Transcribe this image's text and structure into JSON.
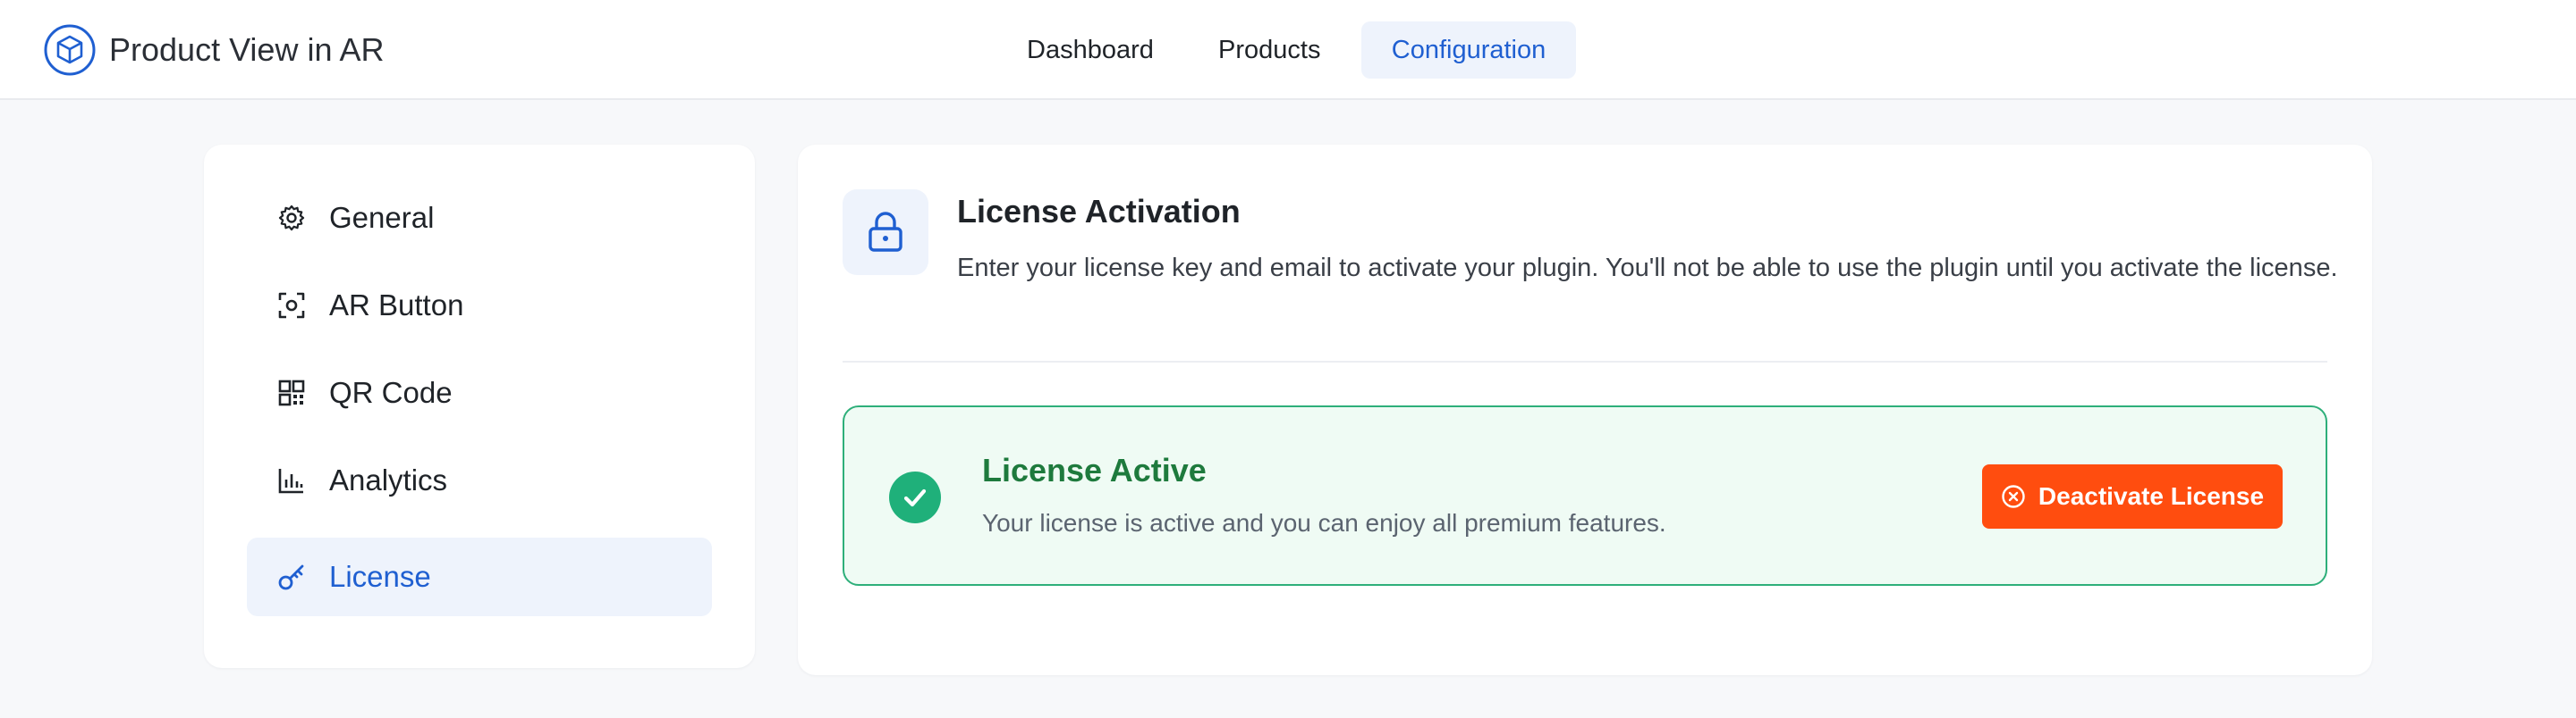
{
  "app": {
    "title": "Product View in AR",
    "brand_color": "#1f5fd1"
  },
  "nav": {
    "items": [
      {
        "label": "Dashboard",
        "active": false
      },
      {
        "label": "Products",
        "active": false
      },
      {
        "label": "Configuration",
        "active": true
      }
    ]
  },
  "sidebar": {
    "items": [
      {
        "label": "General",
        "icon": "gear-icon",
        "active": false
      },
      {
        "label": "AR Button",
        "icon": "scan-icon",
        "active": false
      },
      {
        "label": "QR Code",
        "icon": "qr-code-icon",
        "active": false
      },
      {
        "label": "Analytics",
        "icon": "bar-chart-icon",
        "active": false
      },
      {
        "label": "License",
        "icon": "key-icon",
        "active": true
      }
    ]
  },
  "license": {
    "icon": "lock-icon",
    "title": "License Activation",
    "description": "Enter your license key and email to activate your plugin. You'll not be able to use the plugin until you activate the license.",
    "status": {
      "title": "License Active",
      "text": "Your license is active and you can enjoy all premium features.",
      "icon": "check-circle-icon",
      "color": "#1e7a3d"
    },
    "deactivate_label": "Deactivate License",
    "deactivate_color": "#ff4d0f"
  }
}
